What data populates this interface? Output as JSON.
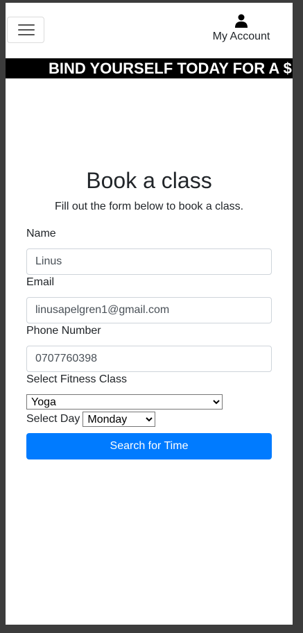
{
  "navbar": {
    "account_label": "My Account",
    "menu_icon": "hamburger-icon",
    "account_icon": "user-icon"
  },
  "ticker": {
    "text": "BIND YOURSELF TODAY FOR A $"
  },
  "form": {
    "title": "Book a class",
    "subtitle": "Fill out the form below to book a class.",
    "name_label": "Name",
    "name_value": "Linus",
    "email_label": "Email",
    "email_value": "linusapelgren1@gmail.com",
    "phone_label": "Phone Number",
    "phone_value": "0707760398",
    "class_label": "Select Fitness Class",
    "class_selected": "Yoga",
    "day_label": "Select Day",
    "day_selected": "Monday",
    "submit_label": "Search for Time"
  },
  "colors": {
    "primary": "#007bff",
    "ticker_bg": "#000000",
    "ticker_text": "#ffffff"
  }
}
